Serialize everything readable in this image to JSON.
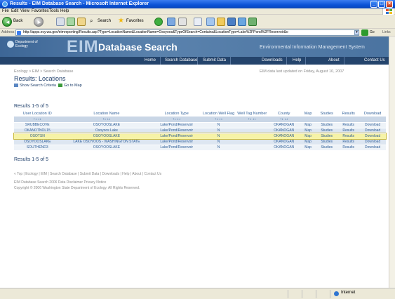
{
  "window": {
    "title": "Results - EIM Database Search - Microsoft Internet Explorer",
    "controls": {
      "minimize": "_",
      "maximize": "□",
      "close": "×"
    }
  },
  "menu": [
    "File",
    "Edit",
    "View",
    "Favorites",
    "Tools",
    "Help"
  ],
  "toolbar": {
    "back": "Back",
    "search": "Search",
    "favorites": "Favorites"
  },
  "address": {
    "label": "Address",
    "url": "http://apps.ecy.wa.gov/eimreporting/Results.asp?Type=LocationName&LocationName=Osoyoos&TypeOfSearch=Contains&LocationType=Lake%2FPond%2FReservoir&o",
    "go": "Go",
    "links": "Links"
  },
  "banner": {
    "agency": "Department of Ecology",
    "eim": "EIM",
    "title": "Database Search",
    "system": "Environmental Information Management System"
  },
  "nav": [
    "Home",
    "Search Database",
    "Submit Data",
    "Downloads",
    "Help",
    "About",
    "Contact Us"
  ],
  "breadcrumb": "Ecology > EIM > Search Database",
  "updated": "EIM data last updated on Friday, August 10, 2007",
  "page_title": "Results: Locations",
  "links": {
    "show_criteria": "Show Search Criteria",
    "go_to_map": "Go to Map"
  },
  "results_count": "Results 1-5 of 5",
  "table": {
    "columns": [
      "User Location ID",
      "Location Name",
      "Location Type",
      "Location Well Flag",
      "Well Tag Number",
      "County",
      "Map",
      "Studies",
      "Results",
      "Download"
    ],
    "sort": [
      "↑↓ ↓↓",
      "↑↓ ↓↓",
      "↑↓ ↓↓",
      "↑↓ ↓↓",
      "↑↓ ↓↓",
      "↑↓ ↓↓",
      "",
      "",
      "",
      ""
    ],
    "rows": [
      [
        "SRUBBECOVE",
        "OSOYOOSLAKE",
        "Lake/Pond/Reservoir",
        "N",
        "",
        "OKANOGAN",
        "Map",
        "Studies",
        "Results",
        "Download"
      ],
      [
        "OKANOTNOL15",
        "Osoyoos Lake",
        "Lake/Pond/Reservoir",
        "N",
        "",
        "OKANOGAN",
        "Map",
        "Studies",
        "Results",
        "Download"
      ],
      [
        "OSOTSN",
        "OSOYOOSLAKE",
        "Lake/Pond/Reservoir",
        "N",
        "",
        "OKANOGAN",
        "Map",
        "Studies",
        "Results",
        "Download"
      ],
      [
        "OSOYOOSLAKE",
        "LAKE OSOYOOS - WASHINGTON STATE",
        "Lake/Pond/Reservoir",
        "N",
        "",
        "OKANOGAN",
        "Map",
        "Studies",
        "Results",
        "Download"
      ],
      [
        "SOUTHEND3",
        "OSOYOOSLAKE",
        "Lake/Pond/Reservoir",
        "N",
        "",
        "OKANOGAN",
        "Map",
        "Studies",
        "Results",
        "Download"
      ]
    ]
  },
  "footer_nav": "« Top | Ecology | EIM | Search Database | Submit Data | Downloads | Help | About | Contact Us",
  "footer_line1": "EIM Database Search 2006  Data Disclaimer  Privacy Notice",
  "footer_line2": "Copyright © 2006 Washington State Department of Ecology. All Rights Reserved.",
  "status": {
    "zone": "Internet"
  },
  "colors": {
    "title_bar": "#0a52d6",
    "banner": "#4a73a0",
    "nav": "#24446c",
    "link": "#2f5f99",
    "highlight": "#f6f3a7"
  }
}
